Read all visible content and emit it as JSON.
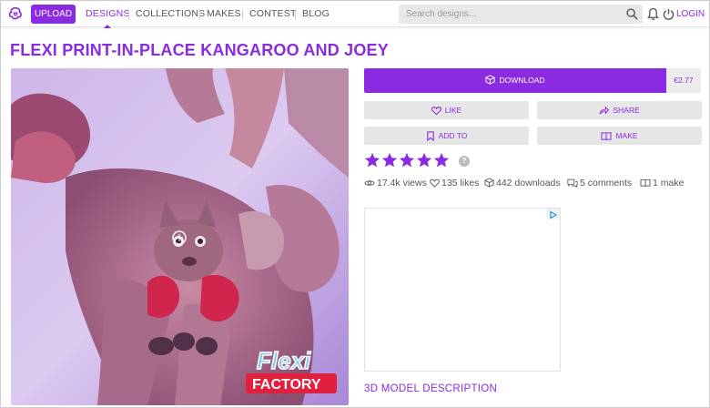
{
  "nav": {
    "upload_label": "UPLOAD",
    "links": [
      "DESIGNS",
      "COLLECTIONS",
      "MAKES",
      "CONTEST",
      "BLOG"
    ],
    "active_link": "DESIGNS",
    "search_placeholder": "Search designs...",
    "login_label": "LOGIN",
    "icons": [
      "cults-logo-icon",
      "search-icon",
      "bell-icon",
      "power-icon"
    ]
  },
  "page": {
    "title": "FLEXI PRINT-IN-PLACE KANGAROO AND JOEY"
  },
  "photo": {
    "brand_line1": "Flexi",
    "brand_line2": "FACTORY"
  },
  "actions": {
    "download_label": "DOWNLOAD",
    "price": "€2.77",
    "like_label": "LIKE",
    "share_label": "SHARE",
    "add_to_label": "ADD TO",
    "make_label": "MAKE"
  },
  "rating": {
    "stars": 5,
    "help": "?"
  },
  "stats": {
    "views": "17.4k views",
    "likes": "135 likes",
    "downloads": "442 downloads",
    "comments": "5 comments",
    "makes": "1 make"
  },
  "description": {
    "link_label": "3D MODEL DESCRIPTION"
  },
  "colors": {
    "accent": "#8a2be2",
    "button_grey": "#e6e6e6"
  }
}
